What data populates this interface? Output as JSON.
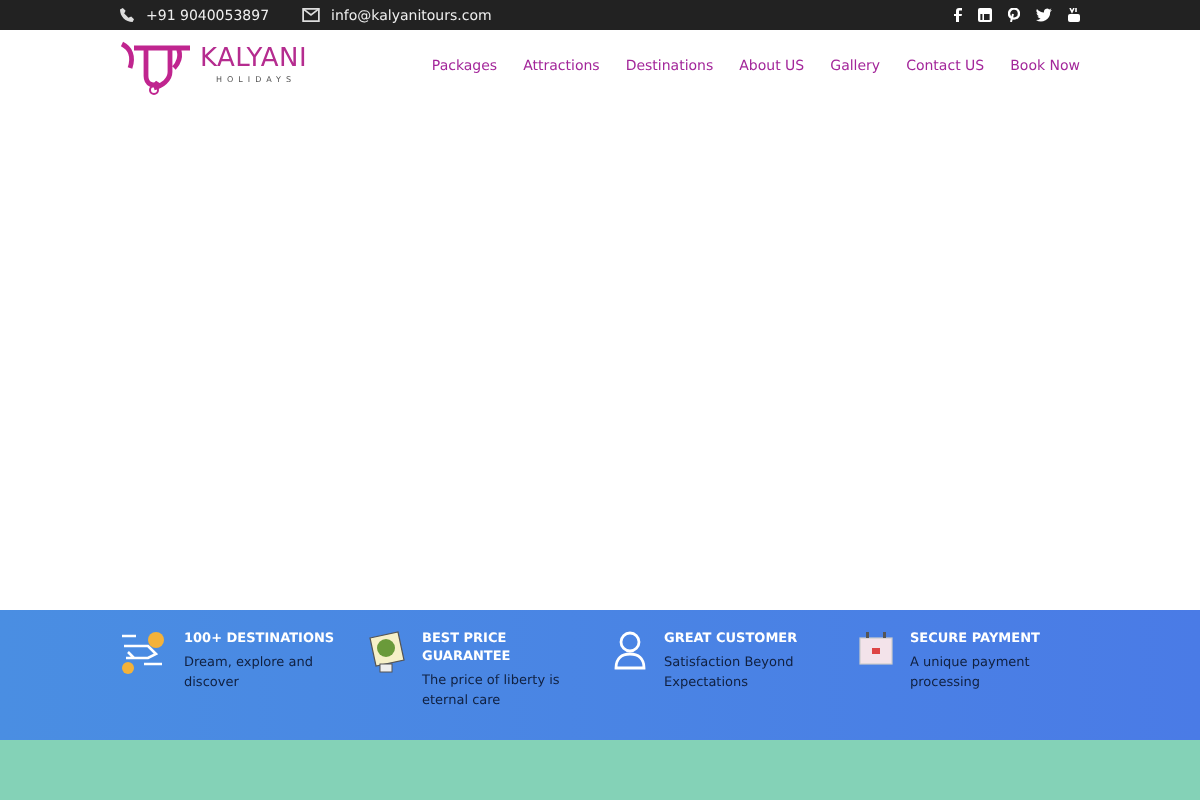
{
  "top_bar": {
    "phone": "+91 9040053897",
    "email": "info@kalyanitours.com",
    "social": [
      {
        "kind": "facebook"
      },
      {
        "kind": "linkedin"
      },
      {
        "kind": "pinterest"
      },
      {
        "kind": "twitter"
      },
      {
        "kind": "youtube"
      }
    ]
  },
  "logo": {
    "name": "KALYANI",
    "tagline": "HOLIDAYS"
  },
  "nav": [
    {
      "label": "Packages"
    },
    {
      "label": "Attractions"
    },
    {
      "label": "Destinations"
    },
    {
      "label": "About US"
    },
    {
      "label": "Gallery"
    },
    {
      "label": "Contact US"
    },
    {
      "label": "Book Now"
    }
  ],
  "features": [
    {
      "kind": "plane",
      "title": "100+ DESTINATIONS",
      "text": "Dream, explore and discover"
    },
    {
      "kind": "badge",
      "title": "BEST PRICE GUARANTEE",
      "text": "The price of liberty is eternal care"
    },
    {
      "kind": "person",
      "title": "GREAT CUSTOMER",
      "text": "Satisfaction Beyond Expectations"
    },
    {
      "kind": "calendar",
      "title": "SECURE PAYMENT",
      "text": "A unique payment processing"
    }
  ]
}
